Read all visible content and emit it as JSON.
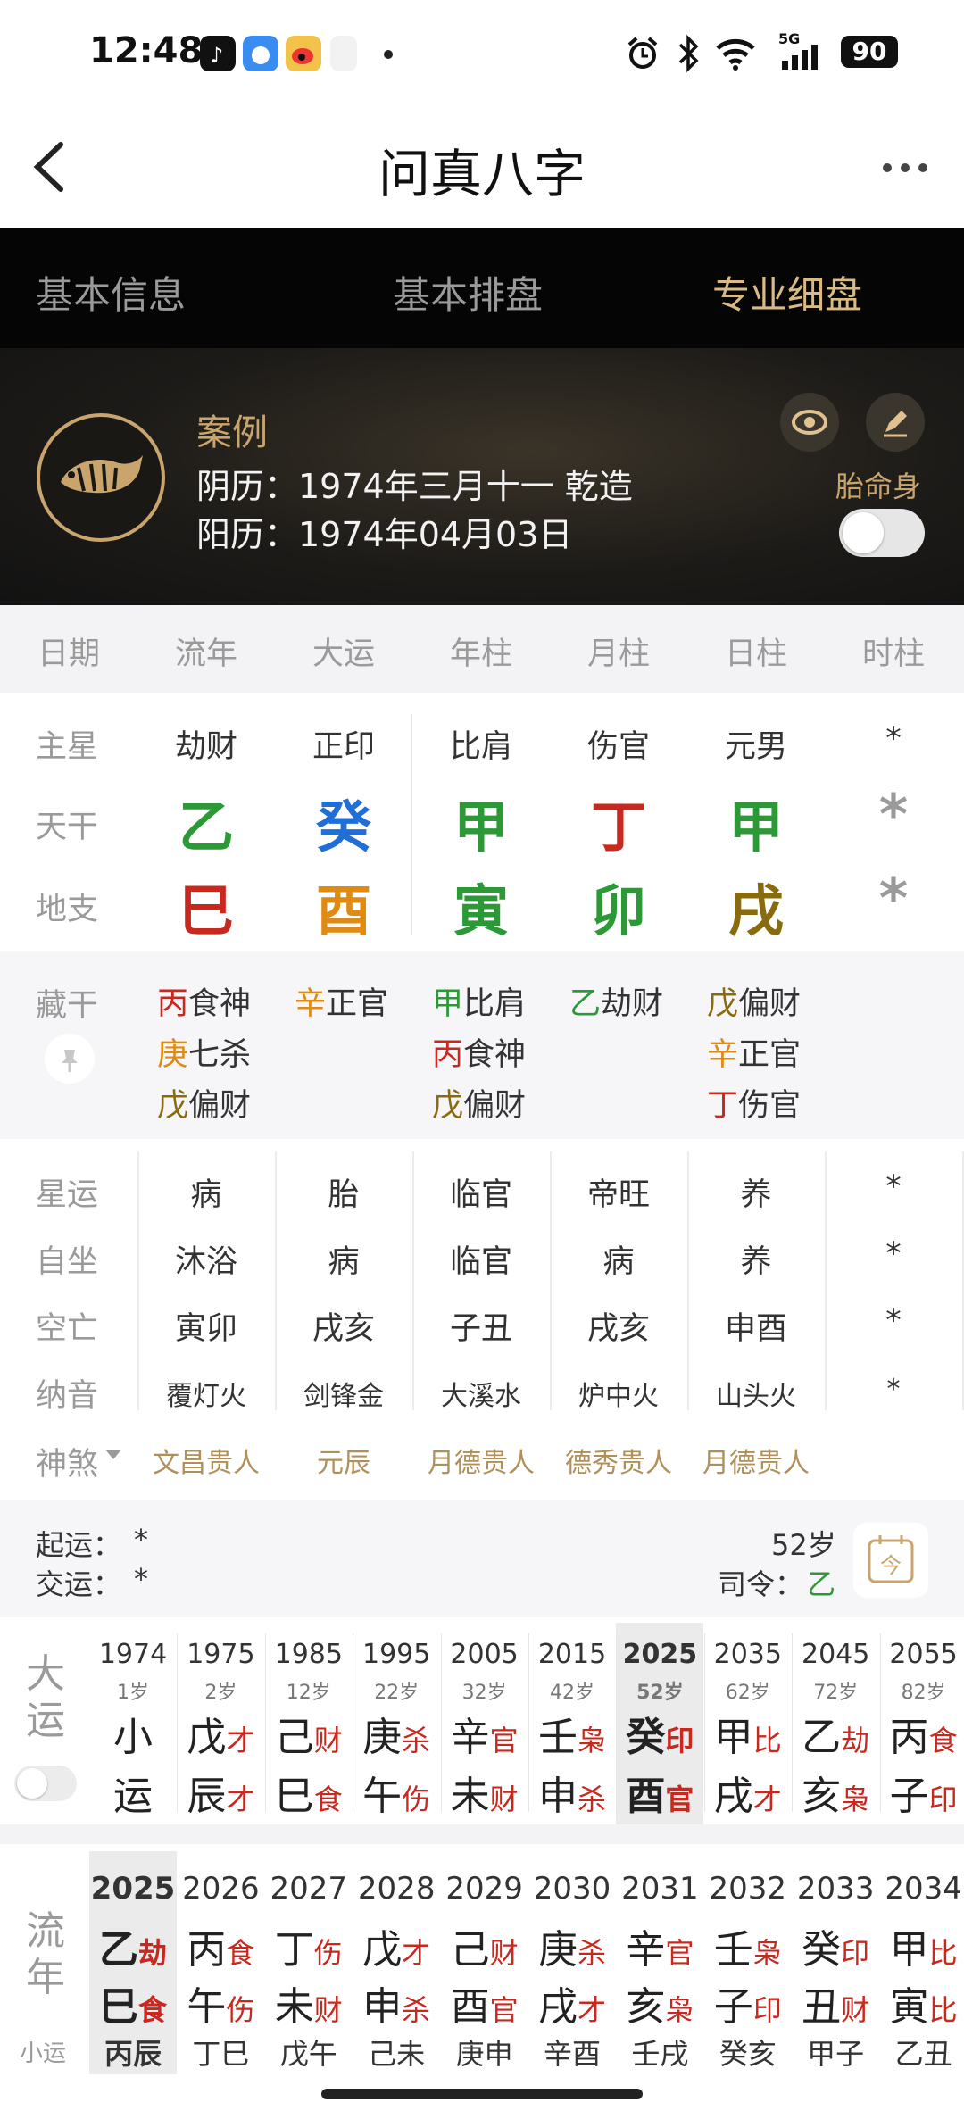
{
  "status": {
    "time": "12:48",
    "signal": "5G",
    "battery": "90"
  },
  "nav": {
    "title": "问真八字"
  },
  "tabs": [
    "基本信息",
    "基本排盘",
    "专业细盘"
  ],
  "profile": {
    "name": "案例",
    "lunar": "阴历：1974年三月十一 乾造",
    "solar": "阳历：1974年04月03日",
    "toggle_label": "胎命身"
  },
  "columns": [
    "日期",
    "流年",
    "大运",
    "年柱",
    "月柱",
    "日柱",
    "时柱"
  ],
  "rows": {
    "zhuxing": {
      "label": "主星",
      "values": [
        "劫财",
        "正印",
        "比肩",
        "伤官",
        "元男",
        "*"
      ]
    },
    "tiangan": {
      "label": "天干",
      "values": [
        "乙",
        "癸",
        "甲",
        "丁",
        "甲",
        "*"
      ],
      "colors": [
        "#2b9a36",
        "#1f6fd6",
        "#2b9a36",
        "#c8281e",
        "#2b9a36",
        "#9a9a9a"
      ]
    },
    "dizhi": {
      "label": "地支",
      "values": [
        "巳",
        "酉",
        "寅",
        "卯",
        "戌",
        "*"
      ],
      "colors": [
        "#c8281e",
        "#e08a12",
        "#2b9a36",
        "#2b9a36",
        "#8a6a0e",
        "#9a9a9a"
      ]
    }
  },
  "canggan": {
    "label": "藏干",
    "cols": [
      [
        {
          "g": "丙",
          "s": "食神",
          "c": "#c8281e"
        },
        {
          "g": "庚",
          "s": "七杀",
          "c": "#e08a12"
        },
        {
          "g": "戊",
          "s": "偏财",
          "c": "#8a6a0e"
        }
      ],
      [
        {
          "g": "辛",
          "s": "正官",
          "c": "#e08a12"
        }
      ],
      [
        {
          "g": "甲",
          "s": "比肩",
          "c": "#2b9a36"
        },
        {
          "g": "丙",
          "s": "食神",
          "c": "#c8281e"
        },
        {
          "g": "戊",
          "s": "偏财",
          "c": "#8a6a0e"
        }
      ],
      [
        {
          "g": "乙",
          "s": "劫财",
          "c": "#2b9a36"
        }
      ],
      [
        {
          "g": "戊",
          "s": "偏财",
          "c": "#8a6a0e"
        },
        {
          "g": "辛",
          "s": "正官",
          "c": "#e08a12"
        },
        {
          "g": "丁",
          "s": "伤官",
          "c": "#c8281e"
        }
      ]
    ]
  },
  "details": [
    {
      "label": "星运",
      "values": [
        "病",
        "胎",
        "临官",
        "帝旺",
        "养",
        "*"
      ]
    },
    {
      "label": "自坐",
      "values": [
        "沐浴",
        "病",
        "临官",
        "病",
        "养",
        "*"
      ]
    },
    {
      "label": "空亡",
      "values": [
        "寅卯",
        "戌亥",
        "子丑",
        "戌亥",
        "申酉",
        "*"
      ]
    },
    {
      "label": "纳音",
      "values": [
        "覆灯火",
        "剑锋金",
        "大溪水",
        "炉中火",
        "山头火",
        "*"
      ]
    }
  ],
  "shensha": {
    "label": "神煞",
    "values": [
      "文昌贵人",
      "元辰",
      "月德贵人",
      "德秀贵人",
      "月德贵人"
    ]
  },
  "qiyun": {
    "qi": "起运：",
    "qi_val": "*",
    "jiao": "交运：",
    "jiao_val": "*",
    "age": "52岁",
    "siling": "司令：",
    "siling_val": "乙",
    "today_icon": "今"
  },
  "dayun": {
    "label": "大运",
    "items": [
      {
        "year": "1974",
        "age": "1岁",
        "g": "小",
        "gs": "",
        "z": "运",
        "zs": ""
      },
      {
        "year": "1975",
        "age": "2岁",
        "g": "戊",
        "gs": "才",
        "z": "辰",
        "zs": "才"
      },
      {
        "year": "1985",
        "age": "12岁",
        "g": "己",
        "gs": "财",
        "z": "巳",
        "zs": "食"
      },
      {
        "year": "1995",
        "age": "22岁",
        "g": "庚",
        "gs": "杀",
        "z": "午",
        "zs": "伤"
      },
      {
        "year": "2005",
        "age": "32岁",
        "g": "辛",
        "gs": "官",
        "z": "未",
        "zs": "财"
      },
      {
        "year": "2015",
        "age": "42岁",
        "g": "壬",
        "gs": "枭",
        "z": "申",
        "zs": "杀"
      },
      {
        "year": "2025",
        "age": "52岁",
        "g": "癸",
        "gs": "印",
        "z": "酉",
        "zs": "官"
      },
      {
        "year": "2035",
        "age": "62岁",
        "g": "甲",
        "gs": "比",
        "z": "戌",
        "zs": "才"
      },
      {
        "year": "2045",
        "age": "72岁",
        "g": "乙",
        "gs": "劫",
        "z": "亥",
        "zs": "枭"
      },
      {
        "year": "2055",
        "age": "82岁",
        "g": "丙",
        "gs": "食",
        "z": "子",
        "zs": "印"
      }
    ]
  },
  "liunian": {
    "label": "流年",
    "sub": "小运",
    "items": [
      {
        "year": "2025",
        "g": "乙",
        "gs": "劫",
        "z": "巳",
        "zs": "食",
        "x": "丙辰"
      },
      {
        "year": "2026",
        "g": "丙",
        "gs": "食",
        "z": "午",
        "zs": "伤",
        "x": "丁巳"
      },
      {
        "year": "2027",
        "g": "丁",
        "gs": "伤",
        "z": "未",
        "zs": "财",
        "x": "戊午"
      },
      {
        "year": "2028",
        "g": "戊",
        "gs": "才",
        "z": "申",
        "zs": "杀",
        "x": "己未"
      },
      {
        "year": "2029",
        "g": "己",
        "gs": "财",
        "z": "酉",
        "zs": "官",
        "x": "庚申"
      },
      {
        "year": "2030",
        "g": "庚",
        "gs": "杀",
        "z": "戌",
        "zs": "才",
        "x": "辛酉"
      },
      {
        "year": "2031",
        "g": "辛",
        "gs": "官",
        "z": "亥",
        "zs": "枭",
        "x": "壬戌"
      },
      {
        "year": "2032",
        "g": "壬",
        "gs": "枭",
        "z": "子",
        "zs": "印",
        "x": "癸亥"
      },
      {
        "year": "2033",
        "g": "癸",
        "gs": "印",
        "z": "丑",
        "zs": "财",
        "x": "甲子"
      },
      {
        "year": "2034",
        "g": "甲",
        "gs": "比",
        "z": "寅",
        "zs": "比",
        "x": "乙丑"
      }
    ]
  }
}
